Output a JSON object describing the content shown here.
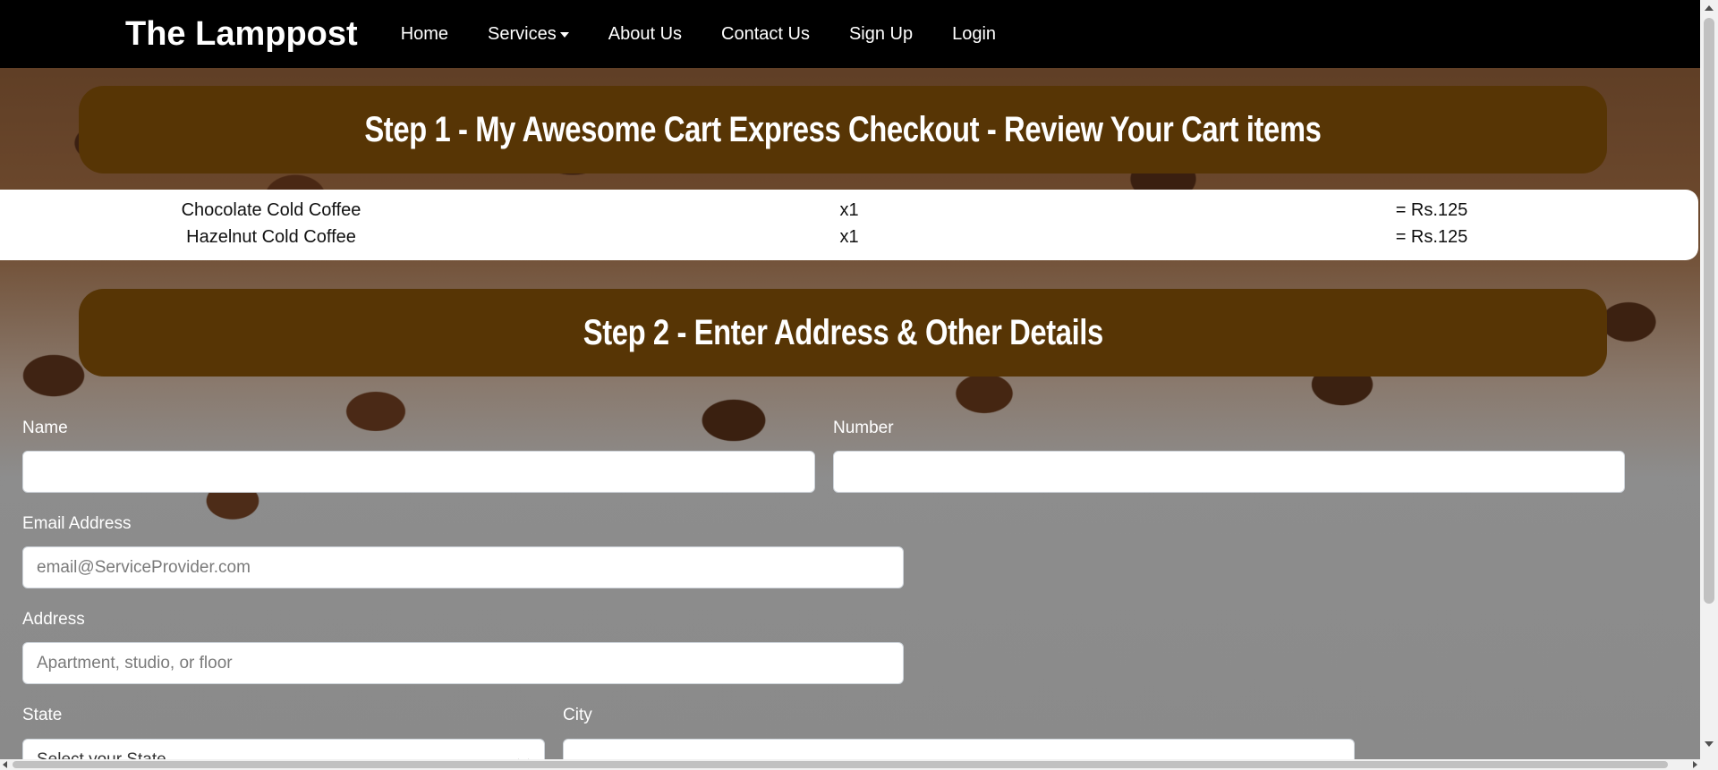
{
  "navbar": {
    "brand": "The Lamppost",
    "links": [
      {
        "label": "Home"
      },
      {
        "label": "Services",
        "dropdown": true
      },
      {
        "label": "About Us"
      },
      {
        "label": "Contact Us"
      },
      {
        "label": "Sign Up"
      },
      {
        "label": "Login"
      }
    ]
  },
  "step1": {
    "title": "Step 1 - My Awesome Cart Express Checkout - Review Your Cart items"
  },
  "cart": {
    "items": [
      {
        "name": "Chocolate Cold Coffee",
        "qty": "x1",
        "price": "= Rs.125"
      },
      {
        "name": "Hazelnut Cold Coffee",
        "qty": "x1",
        "price": "= Rs.125"
      }
    ]
  },
  "step2": {
    "title": "Step 2 - Enter Address & Other Details"
  },
  "form": {
    "name_label": "Name",
    "name_value": "",
    "number_label": "Number",
    "number_value": "",
    "email_label": "Email Address",
    "email_placeholder": "email@ServiceProvider.com",
    "address_label": "Address",
    "address_placeholder": "Apartment, studio, or floor",
    "state_label": "State",
    "state_selected": "Select your State",
    "city_label": "City",
    "city_value": ""
  },
  "colors": {
    "navbar_bg": "#000000",
    "banner_bg": "#573505",
    "banner_text": "#ffffff"
  }
}
